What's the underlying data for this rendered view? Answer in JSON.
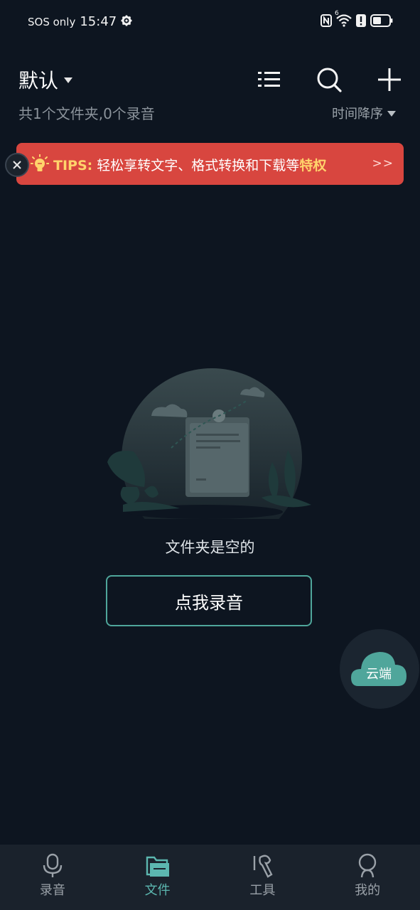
{
  "status_bar": {
    "carrier": "SOS only",
    "time": "15:47",
    "wifi_badge": "6"
  },
  "header": {
    "title": "默认",
    "summary": "共1个文件夹,0个录音",
    "sort_label": "时间降序"
  },
  "tips": {
    "label": "TIPS:",
    "message": "轻松享转文字、格式转换和下载等",
    "highlight": "特权",
    "arrow": ">>"
  },
  "empty_state": {
    "text": "文件夹是空的",
    "button_label": "点我录音"
  },
  "cloud_fab": {
    "label": "云端"
  },
  "bottom_nav": {
    "items": [
      {
        "label": "录音",
        "icon": "microphone-icon",
        "active": false
      },
      {
        "label": "文件",
        "icon": "folder-icon",
        "active": true
      },
      {
        "label": "工具",
        "icon": "wrench-icon",
        "active": false
      },
      {
        "label": "我的",
        "icon": "person-icon",
        "active": false
      }
    ]
  },
  "colors": {
    "background": "#0d1520",
    "tips_red": "#d8463f",
    "tips_yellow": "#ffd36b",
    "accent_teal": "#5cb7b0",
    "button_border": "#4fa69b"
  }
}
